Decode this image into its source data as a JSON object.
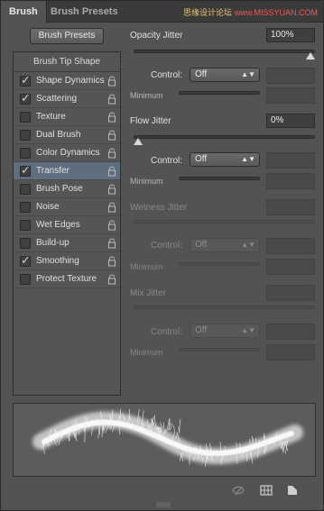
{
  "tabs": {
    "active": "Brush",
    "inactive": "Brush Presets"
  },
  "watermark": {
    "cn": "思缘设计论坛",
    "url": "www.MISSYUAN.COM"
  },
  "presets_button": "Brush Presets",
  "list": {
    "header": "Brush Tip Shape",
    "items": [
      {
        "label": "Shape Dynamics",
        "checked": true,
        "selected": false
      },
      {
        "label": "Scattering",
        "checked": true,
        "selected": false
      },
      {
        "label": "Texture",
        "checked": false,
        "selected": false
      },
      {
        "label": "Dual Brush",
        "checked": false,
        "selected": false
      },
      {
        "label": "Color Dynamics",
        "checked": false,
        "selected": false
      },
      {
        "label": "Transfer",
        "checked": true,
        "selected": true
      },
      {
        "label": "Brush Pose",
        "checked": false,
        "selected": false
      },
      {
        "label": "Noise",
        "checked": false,
        "selected": false
      },
      {
        "label": "Wet Edges",
        "checked": false,
        "selected": false
      },
      {
        "label": "Build-up",
        "checked": false,
        "selected": false
      },
      {
        "label": "Smoothing",
        "checked": true,
        "selected": false
      },
      {
        "label": "Protect Texture",
        "checked": false,
        "selected": false
      }
    ]
  },
  "opacity_jitter": {
    "label": "Opacity Jitter",
    "value": "100%",
    "control_label": "Control:",
    "control_value": "Off",
    "minimum_label": "Minimum",
    "level": 1.0
  },
  "flow_jitter": {
    "label": "Flow Jitter",
    "value": "0%",
    "control_label": "Control:",
    "control_value": "Off",
    "minimum_label": "Minimum",
    "level": 0.0
  },
  "wetness_jitter": {
    "label": "Wetness Jitter",
    "control_label": "Control:",
    "control_value": "Off",
    "minimum_label": "Minimum"
  },
  "mix_jitter": {
    "label": "Mix Jitter",
    "control_label": "Control:",
    "control_value": "Off",
    "minimum_label": "Minimum"
  }
}
